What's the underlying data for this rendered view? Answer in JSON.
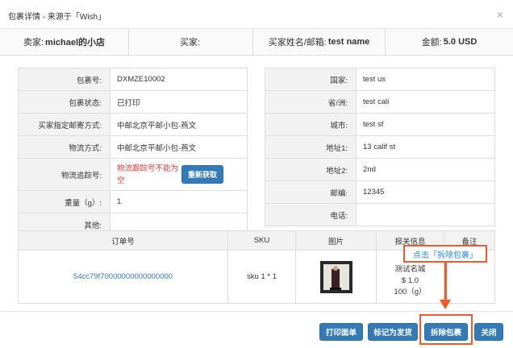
{
  "dialog": {
    "title": "包裹详情 - 来源于「Wish」",
    "close_glyph": "×"
  },
  "summary": {
    "seller_label": "卖家:",
    "seller_value": "michael的小店",
    "buyer_label": "买家:",
    "buyer_value": "",
    "buyer_name_label": "买家姓名/邮箱:",
    "buyer_name_value": "test name",
    "amount_label": "金额:",
    "amount_value": "5.0 USD"
  },
  "package_info": [
    {
      "label": "包裹号:",
      "value": "DXMZE10002"
    },
    {
      "label": "包裹状态:",
      "value": "已打印"
    },
    {
      "label": "买家指定邮寄方式:",
      "value": "中邮北京平邮小包-燕文"
    },
    {
      "label": "物流方式:",
      "value": "中邮北京平邮小包-燕文"
    },
    {
      "label": "物流追踪号:",
      "value": "物流跟踪号不能为空",
      "button": "重新获取"
    },
    {
      "label": "重量（g）:",
      "value": "1"
    },
    {
      "label": "其他:",
      "value": ""
    }
  ],
  "address_info": [
    {
      "label": "国家:",
      "value": "test us"
    },
    {
      "label": "省/洲:",
      "value": "test cali"
    },
    {
      "label": "城市:",
      "value": "test sf"
    },
    {
      "label": "地址1:",
      "value": "13 calif st"
    },
    {
      "label": "地址2:",
      "value": "2nd"
    },
    {
      "label": "邮编:",
      "value": "12345"
    },
    {
      "label": "电话:",
      "value": ""
    }
  ],
  "orders": {
    "headers": [
      "订单号",
      "SKU",
      "图片",
      "报关信息",
      "备注"
    ],
    "rows": [
      {
        "order_no": "54cc79f70000000000000000",
        "sku": "sku 1 * 1",
        "customs_name": "测试名城",
        "customs_value": "$ 1.0",
        "customs_weight": "100（g）",
        "note": ""
      }
    ]
  },
  "annotation": {
    "callout": "点击「拆除包裹」"
  },
  "footer": {
    "print_label": "打印面单",
    "mark_shipped_label": "标记为发货",
    "split_label": "拆除包裹",
    "close_label": "关闭"
  },
  "colors": {
    "primary": "#337ab7",
    "annotation": "#f05a28",
    "error": "#e53935",
    "link": "#337ab7"
  }
}
